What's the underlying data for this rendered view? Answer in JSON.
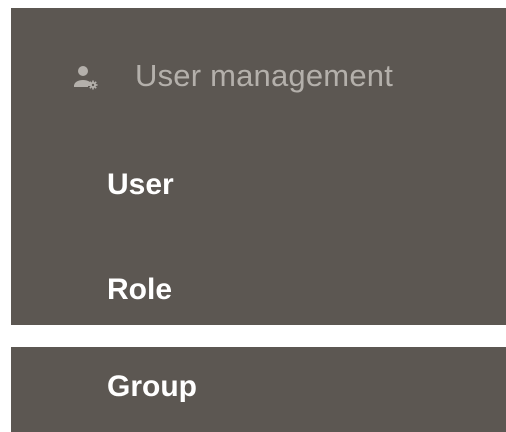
{
  "menu": {
    "header": {
      "label": "User management",
      "icon": "user-gear-icon"
    },
    "items": [
      {
        "label": "User"
      },
      {
        "label": "Role"
      },
      {
        "label": "Group"
      }
    ]
  },
  "colors": {
    "panel_bg": "#5c5752",
    "header_text": "#b4b0ab",
    "item_text": "#ffffff"
  }
}
